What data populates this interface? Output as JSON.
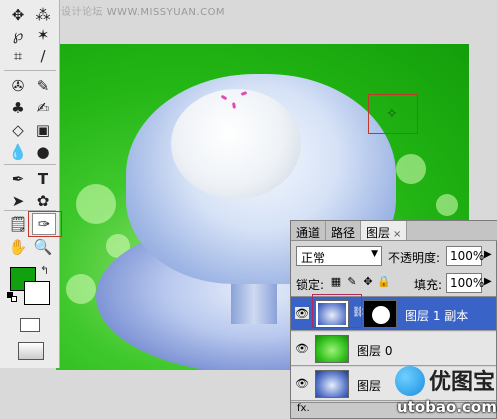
{
  "watermark": {
    "top_text": "思缘设计论坛",
    "top_url": "WWW.MISSYUAN.COM",
    "logo_title": "优图宝",
    "logo_url": "utobao.com"
  },
  "colors": {
    "foreground": "#12a10e",
    "background": "#ffffff",
    "selected_layer": "#3a63c7"
  },
  "toolbox": {
    "tools": [
      "move-tool",
      "magic-wand-tool",
      "lasso-tool",
      "crop-tool",
      "slice-tool",
      "healing-brush-tool",
      "brush-tool",
      "clone-stamp-tool",
      "history-brush-tool",
      "eraser-tool",
      "gradient-tool",
      "blur-tool",
      "dodge-tool",
      "pen-tool",
      "type-tool",
      "path-selection-tool",
      "custom-shape-tool",
      "notes-tool",
      "eyedropper-tool",
      "hand-tool",
      "zoom-tool"
    ],
    "active_tool": "eyedropper-tool"
  },
  "layers_panel": {
    "tabs": [
      {
        "label": "通道",
        "active": false
      },
      {
        "label": "路径",
        "active": false
      },
      {
        "label": "图层",
        "active": true
      }
    ],
    "close_glyph": "×",
    "blend_mode": "正常",
    "opacity_label": "不透明度:",
    "opacity_value": "100%",
    "lock_label": "锁定:",
    "fill_label": "填充:",
    "fill_value": "100%",
    "layers": [
      {
        "name": "图层 1 副本",
        "visible": true,
        "selected": true,
        "has_mask": true,
        "thumb": "blue"
      },
      {
        "name": "图层 0",
        "visible": true,
        "selected": false,
        "has_mask": false,
        "thumb": "green"
      },
      {
        "name": "图层",
        "visible": true,
        "selected": false,
        "has_mask": false,
        "thumb": "blue"
      }
    ],
    "footer_text": "fx."
  }
}
